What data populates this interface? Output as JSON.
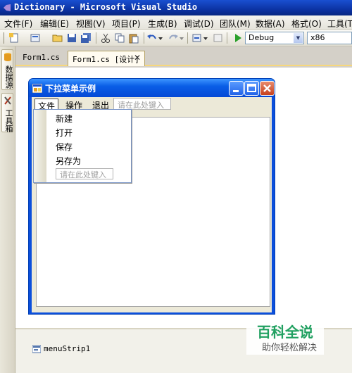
{
  "window": {
    "title": "Dictionary - Microsoft Visual Studio"
  },
  "menubar": {
    "items": [
      "文件(F)",
      "编辑(E)",
      "视图(V)",
      "项目(P)",
      "生成(B)",
      "调试(D)",
      "团队(M)",
      "数据(A)",
      "格式(O)",
      "工具(T)"
    ]
  },
  "toolbar": {
    "config": "Debug",
    "platform": "x86"
  },
  "left_dock": {
    "tabs": [
      "数据源",
      "工具箱"
    ]
  },
  "doc_tabs": [
    {
      "label": "Form1.cs"
    },
    {
      "label": "Form1.cs [设计]",
      "active": true
    }
  ],
  "form": {
    "title": "下拉菜单示例",
    "menu": [
      "文件",
      "操作",
      "退出"
    ],
    "menu_placeholder": "请在此处键入",
    "dropdown": {
      "items": [
        "新建",
        "打开",
        "保存",
        "另存为"
      ],
      "placeholder": "请在此处键入"
    }
  },
  "tray": {
    "component": "menuStrip1"
  },
  "watermark": {
    "brand": "百科全说",
    "slogan": "助你轻松解决"
  },
  "colors": {
    "accent": "#0a5ee6",
    "tab_highlight": "#f7d77b",
    "watermark_green": "#20a060"
  }
}
